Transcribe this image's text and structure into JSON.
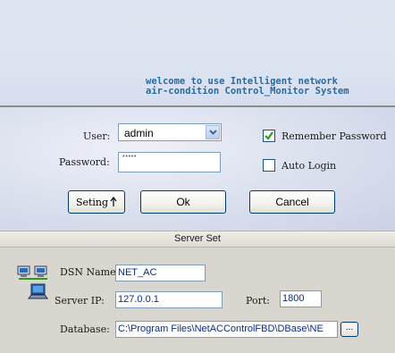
{
  "welcome": {
    "line1": "welcome to use Intelligent network",
    "line2": "air-condition Control_Monitor System"
  },
  "login": {
    "user_label": "User:",
    "user_value": "admin",
    "password_label": "Password:",
    "password_value": "*****",
    "remember_label": "Remember Password",
    "remember_checked": true,
    "auto_login_label": "Auto Login",
    "auto_login_checked": false
  },
  "buttons": {
    "seting": "Seting",
    "ok": "Ok",
    "cancel": "Cancel",
    "browse": "..."
  },
  "server": {
    "header": "Server Set",
    "dsn_label": "DSN Name:",
    "dsn_value": "NET_AC",
    "ip_label": "Server IP:",
    "ip_value": "127.0.0.1",
    "port_label": "Port:",
    "port_value": "1800",
    "db_label": "Database:",
    "db_value": "C:\\Program Files\\NetACControlFBD\\DBase\\NE"
  },
  "colors": {
    "welcome_text": "#2a6aa0",
    "field_text": "#0a2a8c",
    "check_mark": "#2b9a1e"
  },
  "icons": [
    "network-computers-icon",
    "database-server-icon",
    "arrow-up-icon",
    "chevron-down-icon",
    "checkmark-icon"
  ]
}
